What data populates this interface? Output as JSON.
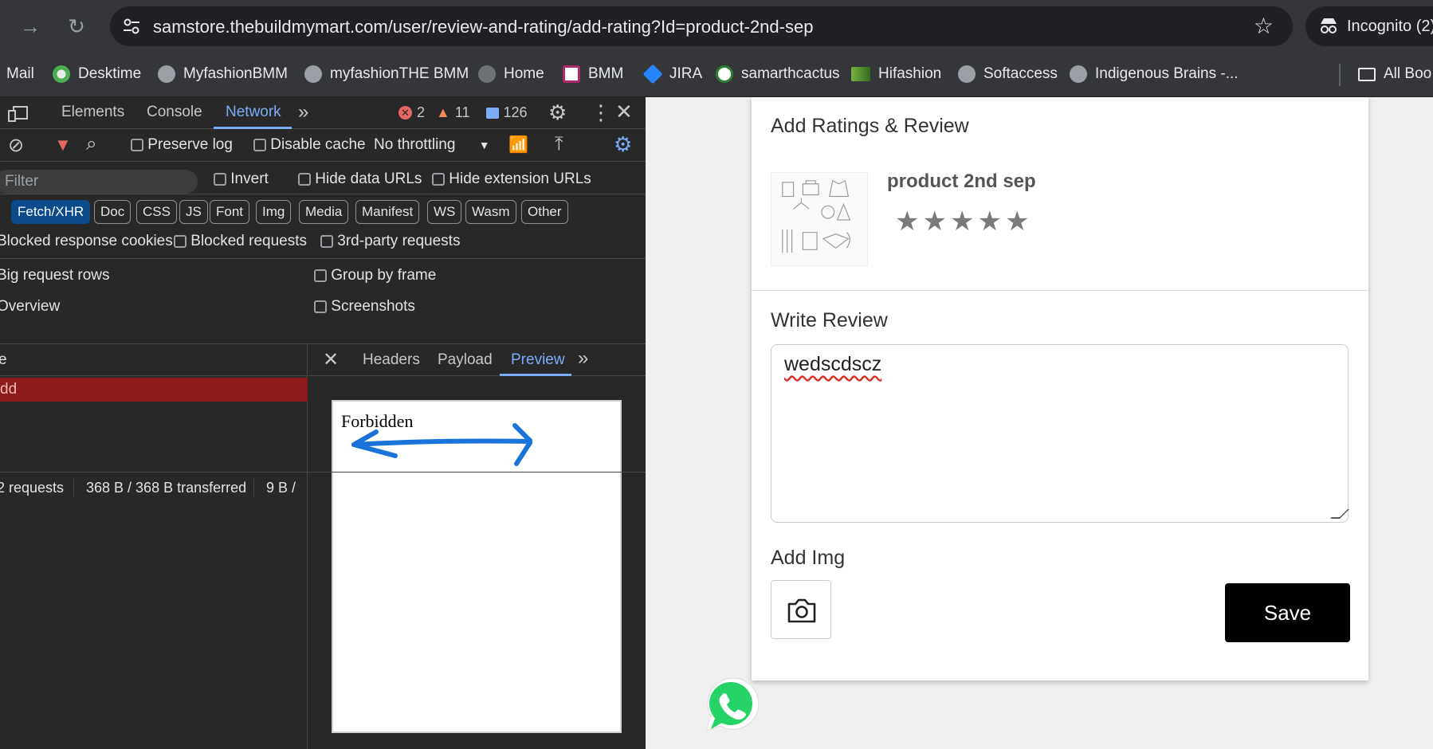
{
  "browser": {
    "url": "samstore.thebuildmymart.com/user/review-and-rating/add-rating?Id=product-2nd-sep",
    "incognito_label": "Incognito (2)",
    "bookmarks": [
      {
        "label": "Mail",
        "icon": "mail-icon"
      },
      {
        "label": "Desktime",
        "icon": "desktime-icon"
      },
      {
        "label": "MyfashionBMM",
        "icon": "globe-icon"
      },
      {
        "label": "myfashionTHE BMM",
        "icon": "globe-icon"
      },
      {
        "label": "Home",
        "icon": "globe-icon"
      },
      {
        "label": "BMM",
        "icon": "bmm-icon"
      },
      {
        "label": "JIRA",
        "icon": "jira-icon"
      },
      {
        "label": "samarthcactus",
        "icon": "cactus-icon"
      },
      {
        "label": "Hifashion",
        "icon": "hifashion-icon"
      },
      {
        "label": "Softaccess",
        "icon": "globe-icon"
      },
      {
        "label": "Indigenous Brains -...",
        "icon": "globe-icon"
      },
      {
        "label": "All Boo",
        "icon": "folder-icon"
      }
    ]
  },
  "devtools": {
    "tabs": [
      "Elements",
      "Console",
      "Network"
    ],
    "active_tab": "Network",
    "errors": "2",
    "warnings": "11",
    "messages": "126",
    "toolbar": {
      "preserve_log": "Preserve log",
      "disable_cache": "Disable cache",
      "throttling": "No throttling"
    },
    "filter": {
      "placeholder": "Filter",
      "invert": "Invert",
      "hide_data_urls": "Hide data URLs",
      "hide_extension_urls": "Hide extension URLs"
    },
    "type_chips": [
      "Fetch/XHR",
      "Doc",
      "CSS",
      "JS",
      "Font",
      "Img",
      "Media",
      "Manifest",
      "WS",
      "Wasm",
      "Other"
    ],
    "active_chip": "Fetch/XHR",
    "options": {
      "blocked_cookies": "Blocked response cookies",
      "blocked_requests": "Blocked requests",
      "third_party": "3rd-party requests",
      "big_rows": "Big request rows",
      "group_by_frame": "Group by frame",
      "overview": "Overview",
      "screenshots": "Screenshots"
    },
    "request_list": {
      "name_header": "e",
      "selected_row": "dd"
    },
    "detail_tabs": [
      "Headers",
      "Payload",
      "Preview"
    ],
    "active_detail_tab": "Preview",
    "preview_text": "Forbidden",
    "footer": {
      "requests": "2 requests",
      "transferred": "368 B / 368 B transferred",
      "resources": "9 B /"
    }
  },
  "page": {
    "title": "Add Ratings & Review",
    "product_name": "product 2nd sep",
    "rating": 5,
    "stars": [
      "★",
      "★",
      "★",
      "★",
      "★"
    ],
    "write_review_label": "Write Review",
    "review_text": "wedscdscz",
    "add_img_label": "Add Img",
    "save_label": "Save"
  }
}
